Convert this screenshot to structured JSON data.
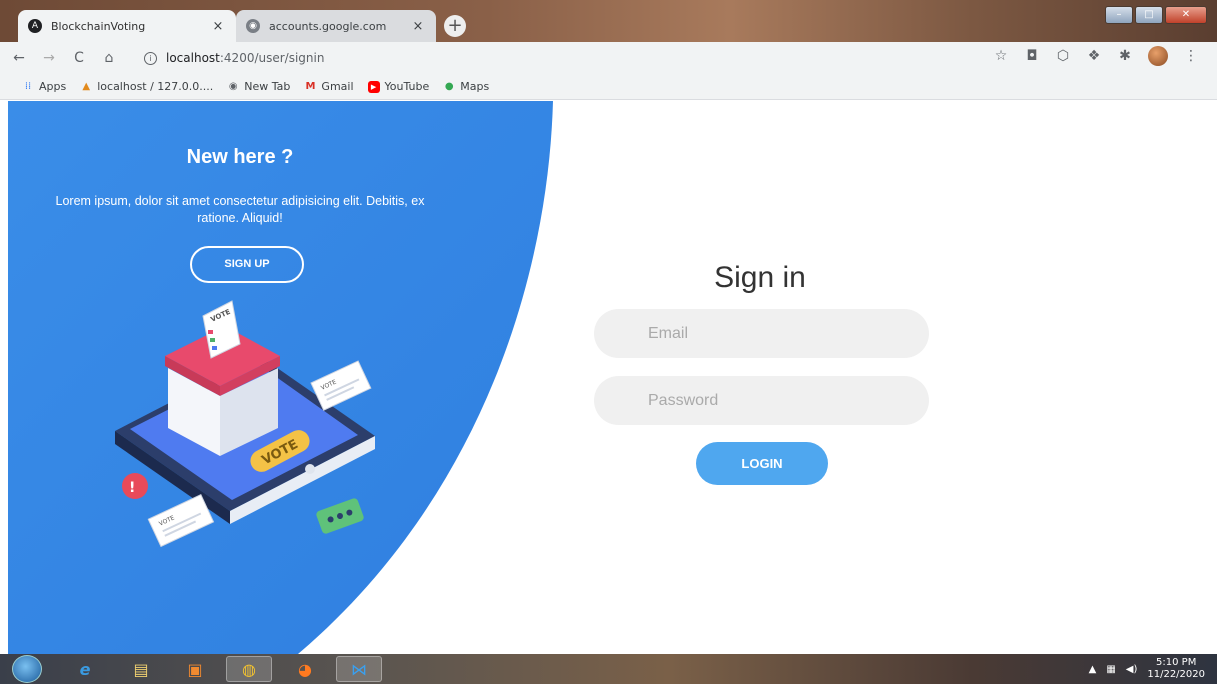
{
  "browser": {
    "tabs": [
      {
        "title": "BlockchainVoting",
        "active": true
      },
      {
        "title": "accounts.google.com",
        "active": false
      }
    ],
    "close_glyph": "×",
    "new_tab_glyph": "+",
    "url_host": "localhost",
    "url_path": ":4200/user/signin",
    "bookmarks": [
      {
        "label": "Apps",
        "icon": "apps-grid-icon"
      },
      {
        "label": "localhost / 127.0.0....",
        "icon": "phpmyadmin-icon"
      },
      {
        "label": "New Tab",
        "icon": "globe-icon"
      },
      {
        "label": "Gmail",
        "icon": "gmail-icon"
      },
      {
        "label": "YouTube",
        "icon": "youtube-icon"
      },
      {
        "label": "Maps",
        "icon": "maps-icon"
      }
    ]
  },
  "panel": {
    "heading": "New here ?",
    "description": "Lorem ipsum, dolor sit amet consectetur adipisicing elit. Debitis, ex ratione. Aliquid!",
    "signup_label": "SIGN UP",
    "illustration_vote_labels": [
      "VOTE",
      "VOTE",
      "VOTE",
      "VOTE"
    ]
  },
  "signin": {
    "title": "Sign in",
    "email_placeholder": "Email",
    "password_placeholder": "Password",
    "login_label": "LOGIN"
  },
  "taskbar": {
    "time": "5:10 PM",
    "date": "11/22/2020"
  },
  "colors": {
    "panel_blue": "#3b8fea",
    "login_blue": "#4fa7ef",
    "field_bg": "#f0f0f0"
  }
}
